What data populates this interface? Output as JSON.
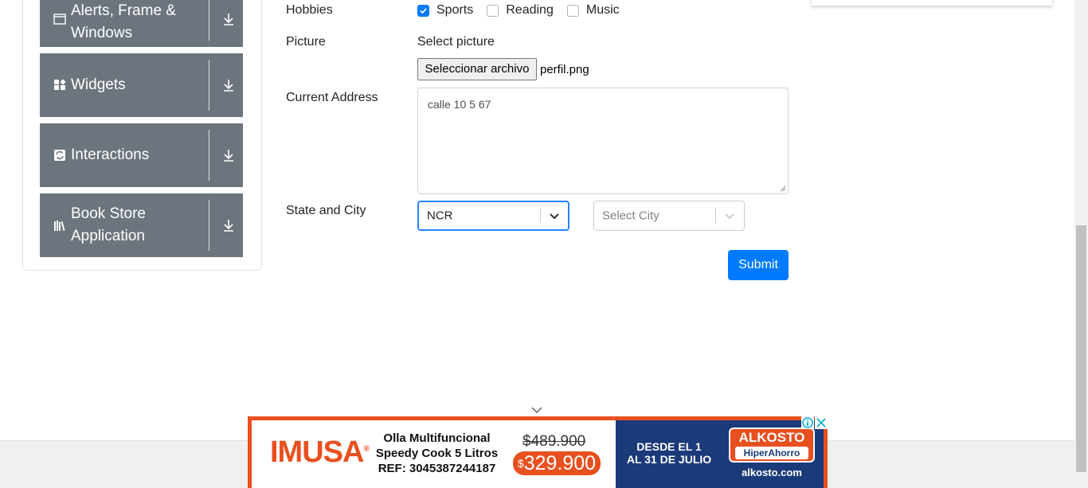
{
  "sidebar": {
    "groups": [
      {
        "label": "Alerts, Frame & Windows",
        "icon": "window-icon"
      },
      {
        "label": "Widgets",
        "icon": "widgets-icon"
      },
      {
        "label": "Interactions",
        "icon": "interactions-icon"
      },
      {
        "label": "Book Store Application",
        "icon": "books-icon"
      }
    ]
  },
  "form": {
    "hobbies_label": "Hobbies",
    "hobbies": [
      {
        "label": "Sports",
        "checked": true
      },
      {
        "label": "Reading",
        "checked": false
      },
      {
        "label": "Music",
        "checked": false
      }
    ],
    "picture_label": "Picture",
    "picture_hint": "Select picture",
    "file_button": "Seleccionar archivo",
    "file_name": "perfil.png",
    "address_label": "Current Address",
    "address_value": "calle 10 5 67",
    "state_city_label": "State and City",
    "state_value": "NCR",
    "city_placeholder": "Select City",
    "submit_label": "Submit"
  },
  "ad": {
    "brand": "IMUSA",
    "brand_mark": "®",
    "product_line1": "Olla Multifuncional",
    "product_line2": "Speedy Cook 5 Litros",
    "product_line3": "REF: 3045387244187",
    "old_price": "$489.900",
    "new_price_symbol": "$",
    "new_price": "329.900",
    "dates_line1": "DESDE EL 1",
    "dates_line2": "AL 31 DE JULIO",
    "store_name": "ALKOSTO",
    "store_tag": "HiperAhorro",
    "store_url": "alkosto.com",
    "colors": {
      "brand_orange": "#e8501f",
      "store_blue": "#1b3a7a"
    }
  },
  "colors": {
    "primary": "#007bff",
    "sidebar_bg": "#6c757d",
    "focus_border": "#2684ff"
  }
}
